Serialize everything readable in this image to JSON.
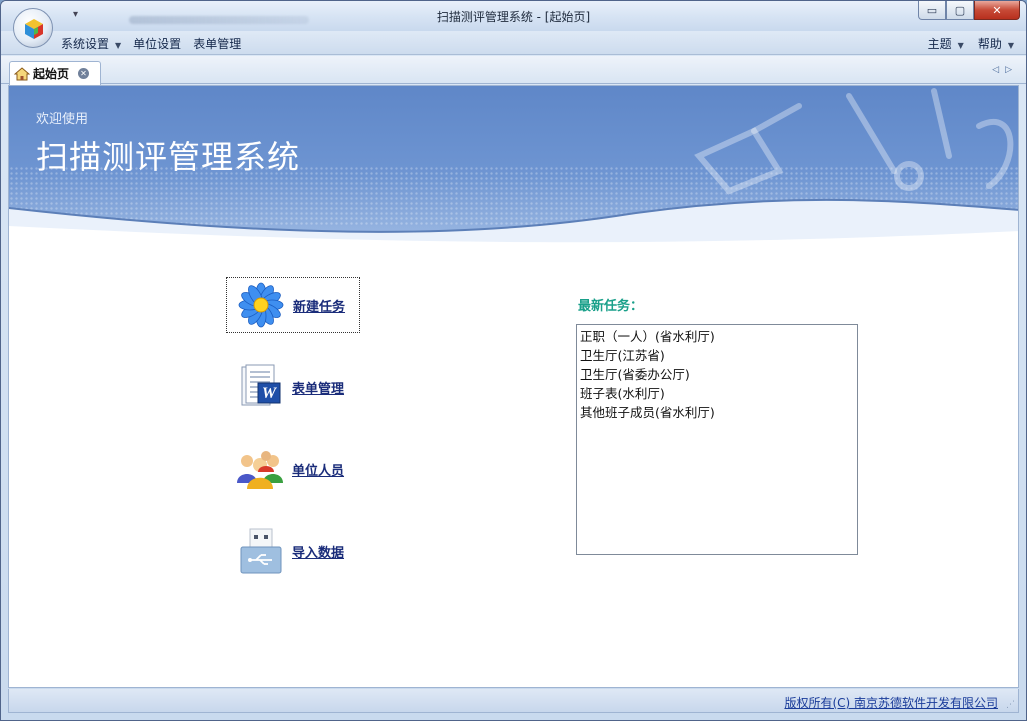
{
  "window": {
    "title": "扫描测评管理系统 - [起始页]",
    "minimize": "▭",
    "maximize": "▢",
    "close": "✕",
    "qat_symbol": "▾"
  },
  "menu": {
    "left": [
      {
        "label": "系统设置",
        "has_dropdown": true
      },
      {
        "label": "单位设置",
        "has_dropdown": false
      },
      {
        "label": "表单管理",
        "has_dropdown": false
      }
    ],
    "right": [
      {
        "label": "主题",
        "has_dropdown": true
      },
      {
        "label": "帮助",
        "has_dropdown": true
      }
    ]
  },
  "tabs": [
    {
      "label": "起始页",
      "icon": "home-icon",
      "active": true
    }
  ],
  "tab_nav": {
    "prev": "◁",
    "next": "▷"
  },
  "banner": {
    "welcome": "欢迎使用",
    "system_name": "扫描测评管理系统"
  },
  "actions": [
    {
      "label": "新建任务",
      "icon": "flower-icon",
      "selected": true
    },
    {
      "label": "表单管理",
      "icon": "word-document-icon",
      "selected": false
    },
    {
      "label": "单位人员",
      "icon": "users-group-icon",
      "selected": false
    },
    {
      "label": "导入数据",
      "icon": "usb-drive-icon",
      "selected": false
    }
  ],
  "recent": {
    "title": "最新任务：",
    "items": [
      "正职（一人）(省水利厅)",
      "卫生厅(江苏省)",
      "卫生厅(省委办公厅)",
      "班子表(水利厅)",
      "其他班子成员(省水利厅)"
    ]
  },
  "status": {
    "copyright": "版权所有(C) 南京苏德软件开发有限公司"
  },
  "colors": {
    "banner": "#6e95d2",
    "recent_title": "#1aa08a",
    "link": "#1a2c7a"
  }
}
